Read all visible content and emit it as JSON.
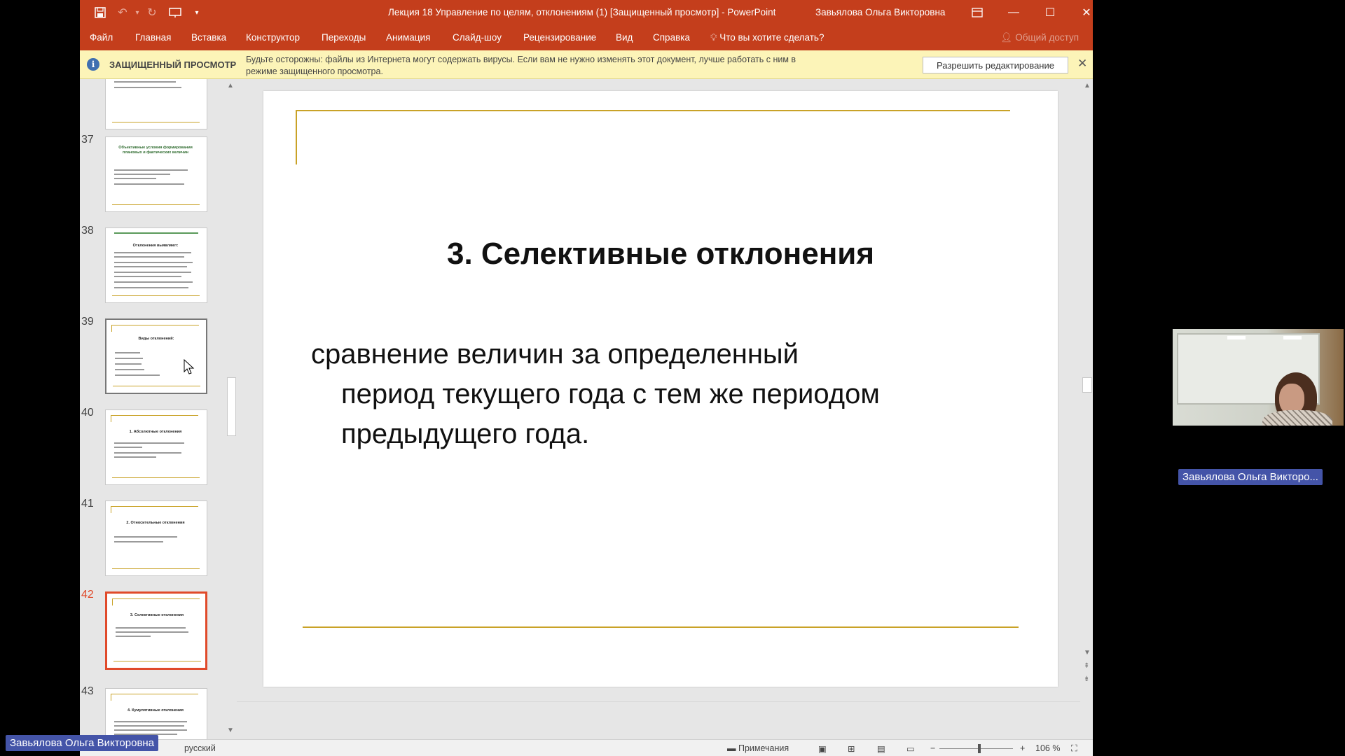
{
  "window": {
    "title": "Лекция 18 Управление по целям, отклонениям (1) [Защищенный просмотр]  -  PowerPoint",
    "user": "Завьялова Ольга Викторовна"
  },
  "ribbon": {
    "tabs": [
      "Файл",
      "Главная",
      "Вставка",
      "Конструктор",
      "Переходы",
      "Анимация",
      "Слайд-шоу",
      "Рецензирование",
      "Вид",
      "Справка"
    ],
    "tell_me": "Что вы хотите сделать?",
    "share": "Общий доступ"
  },
  "protected": {
    "title": "ЗАЩИЩЕННЫЙ ПРОСМОТР",
    "message": "Будьте осторожны: файлы из Интернета могут содержать вирусы. Если вам не нужно изменять этот документ, лучше работать с ним в режиме защищенного просмотра.",
    "enable_button": "Разрешить редактирование"
  },
  "thumbnails": [
    {
      "number": "",
      "title": ""
    },
    {
      "number": "37",
      "title": "Объективные условия формирования плановых и фактических величин"
    },
    {
      "number": "38",
      "title": "Отклонения выявляют:"
    },
    {
      "number": "39",
      "title": "Виды отклонений:"
    },
    {
      "number": "40",
      "title": "1. Абсолютные отклонения"
    },
    {
      "number": "41",
      "title": "2. Относительные отклонения"
    },
    {
      "number": "42",
      "title": "3. Селективные отклонения"
    },
    {
      "number": "43",
      "title": "4. Кумулятивные отклонения"
    }
  ],
  "slide": {
    "title": "3. Селективные отклонения",
    "body_line1": "сравнение величин за определенный",
    "body_line2": "период текущего года с тем же периодом",
    "body_line3": "предыдущего года."
  },
  "statusbar": {
    "language": "русский",
    "notes": "Примечания",
    "zoom": "106 %"
  },
  "participants": {
    "video_name": "Завьялова Ольга Викторо...",
    "presenter_name": "Завьялова Ольга Викторовна"
  }
}
